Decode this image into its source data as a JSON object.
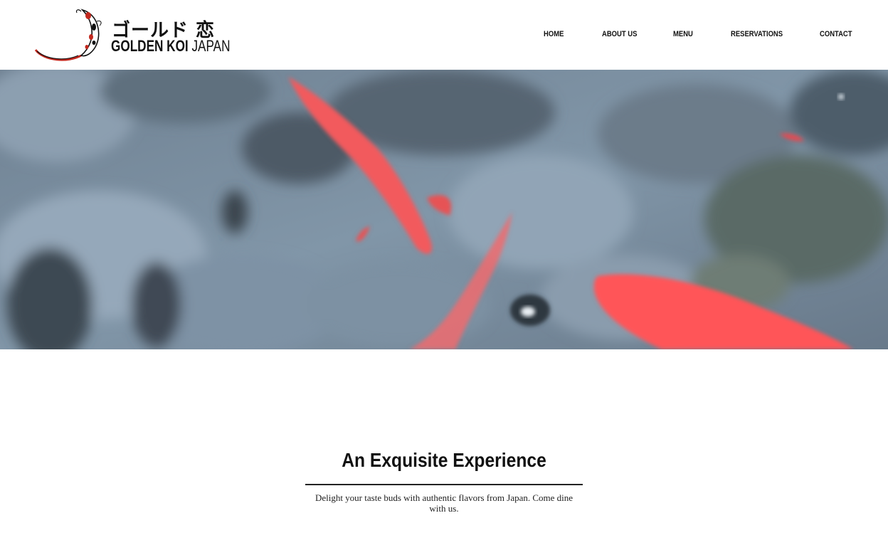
{
  "brand": {
    "name_japanese": "ゴールド 恋",
    "name_bold": "GOLDEN KOI",
    "name_light": "JAPAN"
  },
  "nav": {
    "items": [
      {
        "label": "HOME"
      },
      {
        "label": "ABOUT US"
      },
      {
        "label": "MENU"
      },
      {
        "label": "RESERVATIONS"
      },
      {
        "label": "CONTACT"
      }
    ]
  },
  "hero": {
    "image": "koi-pond-video",
    "colors": {
      "water": "#7f95a8",
      "koi": "#ff5a5f"
    }
  },
  "section": {
    "title": "An Exquisite Experience",
    "description": "Delight your taste buds with authentic flavors from Japan. Come dine with us."
  }
}
